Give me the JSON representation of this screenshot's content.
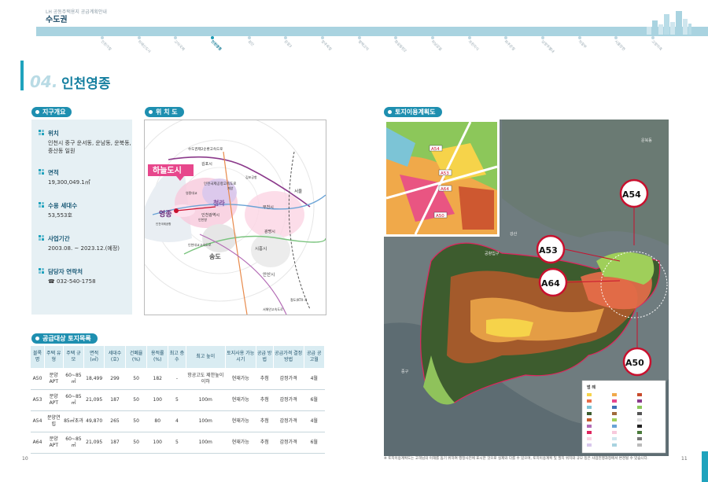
{
  "header": {
    "top_small": "LH 공동주택용지 공급계획안내",
    "region": "수도권",
    "nav_items": [
      "인천가정",
      "위례신도시",
      "고덕국제",
      "인천영종",
      "검단",
      "운정3",
      "양주옥정",
      "평택고덕",
      "화성동탄2",
      "하남감일",
      "과천지식",
      "파주운정",
      "남양주별내",
      "의정부",
      "시흥장현",
      "고양지축"
    ],
    "active_nav_index": 3
  },
  "section": {
    "number": "04.",
    "title": "인천영종"
  },
  "overview": {
    "pill": "지구개요",
    "items": [
      {
        "label": "위치",
        "value": "인천시 중구 운서동, 운남동, 운북동, 중산동 일원"
      },
      {
        "label": "면적",
        "value": "19,300,049.1㎡"
      },
      {
        "label": "수용 세대수",
        "value": "53,553호"
      },
      {
        "label": "사업기간",
        "value": "2003.08. ~ 2023.12.(예정)"
      },
      {
        "label": "담당자 연락처",
        "value": "☎ 032-540-1758"
      }
    ]
  },
  "location_map": {
    "pill": "위 치 도",
    "callout": "하늘도시",
    "labels": {
      "yeongjong": "영종",
      "cheongna": "청라",
      "songdo": "송도",
      "incheon": "인천광역시",
      "bucheon": "부천시",
      "gwangmyeong": "광명시",
      "siheung": "시흥시",
      "ansan": "안산시",
      "seoul": "서울",
      "gimpo": "김포시",
      "airport": "인천국제공항",
      "expressway1": "수도권제2순환고속도로",
      "expressway2": "인천국제공항고속도로",
      "expressway3": "인천대교고속도로",
      "expressway4": "서해안고속도로",
      "rail": "철도(KTX·국",
      "bridge": "영종대교",
      "port": "인천항",
      "gyeyang": "계양",
      "gimpo_airport": "김포공항"
    }
  },
  "land_use": {
    "pill": "토지이용계획도",
    "markers": [
      "A54",
      "A53",
      "A64",
      "A50"
    ],
    "inset_labels": [
      "A54",
      "A53",
      "A64",
      "A50"
    ],
    "place_labels": {
      "unbuk": "운북동",
      "junggu": "중구",
      "gangsan": "강산",
      "hwangjigu": "공항입구"
    },
    "legend_title": "범  례",
    "footnote": "※ 토지이용계획도는 고객님의 이해를 돕기 위하여 행정사진에 표시한 것으로 실제와 다를 수 있으며, 토지이용계획 및 필지 위치와 규모 등은 사업진행과정에서 변경될 수 있습니다."
  },
  "supply_table": {
    "pill": "공급대상 토지목록",
    "headers": [
      "블록명",
      "주택 유형",
      "주택 규모",
      "면적 (㎡)",
      "세대수 (호)",
      "건폐율 (%)",
      "용적률 (%)",
      "최고 층수",
      "최고 높이",
      "토지사용 가능시기",
      "공급 방법",
      "공급가격 결정방법",
      "공급 공고월"
    ],
    "rows": [
      [
        "A50",
        "분양APT",
        "60~85㎡",
        "18,499",
        "299",
        "50",
        "182",
        "-",
        "항공고도 제한높이 이하",
        "현재가능",
        "추첨",
        "감정가격",
        "4월"
      ],
      [
        "A53",
        "분양APT",
        "60~85㎡",
        "21,095",
        "187",
        "50",
        "100",
        "5",
        "100m",
        "현재가능",
        "추첨",
        "감정가격",
        "6월"
      ],
      [
        "A54",
        "분양연립",
        "85㎡초과",
        "49,870",
        "265",
        "50",
        "80",
        "4",
        "100m",
        "현재가능",
        "추첨",
        "감정가격",
        "4월"
      ],
      [
        "A64",
        "분양APT",
        "60~85㎡",
        "21,095",
        "187",
        "50",
        "100",
        "5",
        "100m",
        "현재가능",
        "추첨",
        "감정가격",
        "6월"
      ]
    ]
  },
  "page_numbers": {
    "left": "10",
    "right": "11"
  },
  "colors": {
    "accent": "#1fa3bd",
    "pill": "#1e8fb0",
    "marker_red": "#c8102e"
  }
}
